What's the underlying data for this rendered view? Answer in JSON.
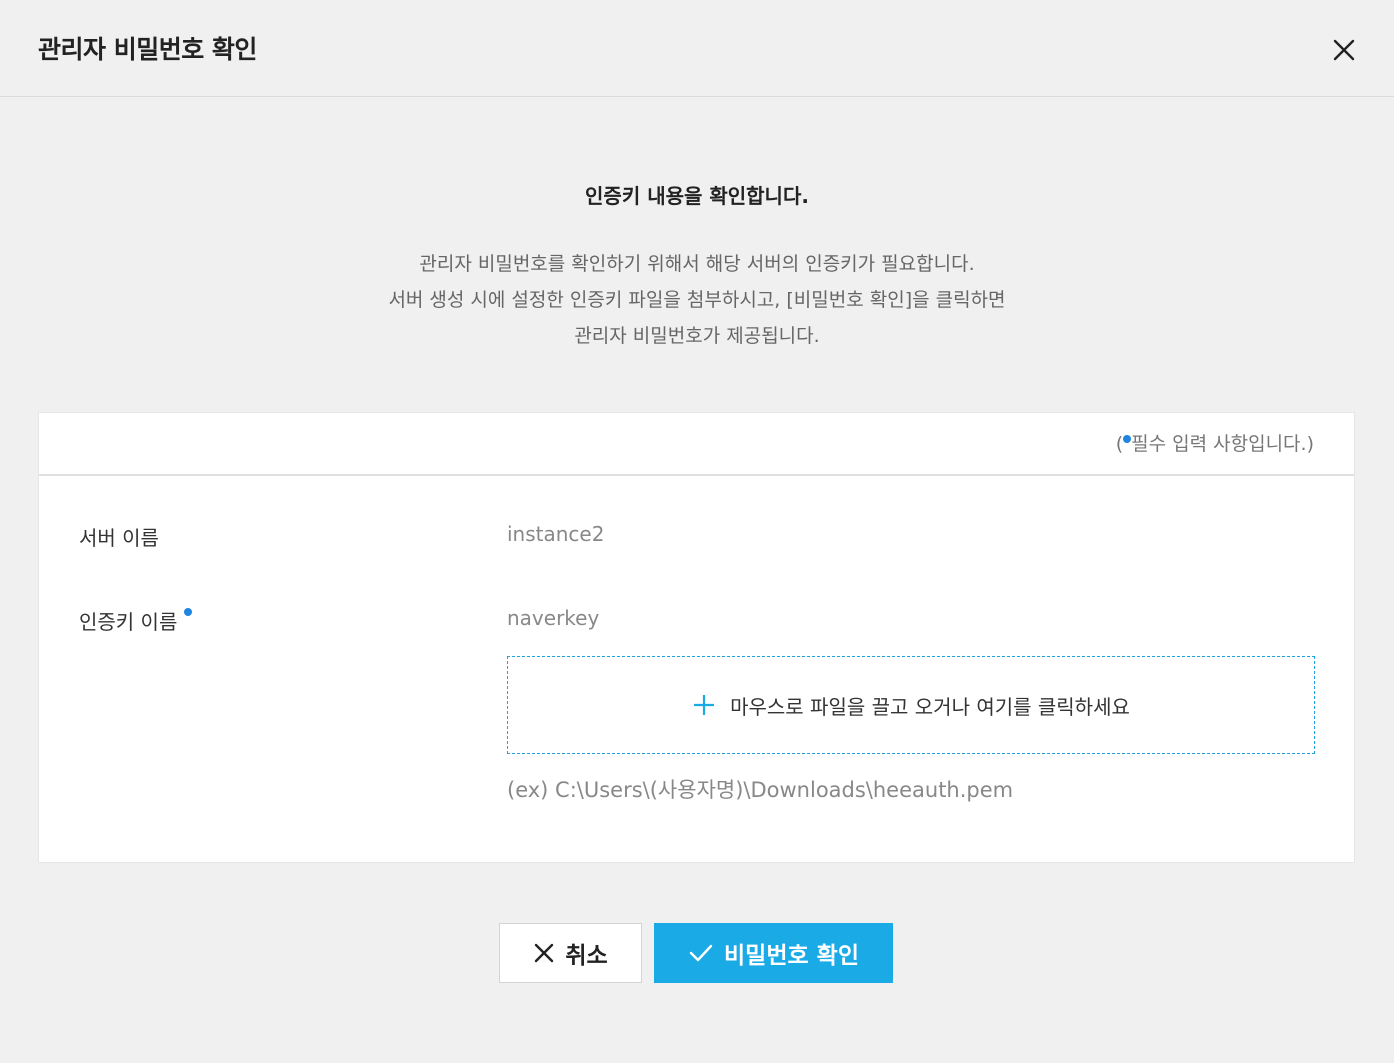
{
  "dialog": {
    "title": "관리자 비밀번호 확인"
  },
  "intro": {
    "title": "인증키 내용을 확인합니다.",
    "lines": [
      "관리자 비밀번호를 확인하기 위해서 해당 서버의 인증키가 필요합니다.",
      "서버 생성 시에 설정한 인증키 파일을 첨부하시고, [비밀번호 확인]을 클릭하면",
      "관리자 비밀번호가 제공됩니다."
    ]
  },
  "form": {
    "required_note_prefix": "(",
    "required_note_text": "필수 입력 사항입니다.)",
    "server_name_label": "서버 이름",
    "server_name_value": "instance2",
    "key_name_label": "인증키 이름",
    "key_name_value": "naverkey",
    "dropzone_text": "마우스로 파일을 끌고 오거나 여기를 클릭하세요",
    "path_example": "(ex) C:\\Users\\(사용자명)\\Downloads\\heeauth.pem"
  },
  "buttons": {
    "cancel_label": "취소",
    "confirm_label": "비밀번호 확인"
  },
  "colors": {
    "accent": "#1aabe6",
    "required_dot": "#1f85de",
    "background": "#f0f0f0"
  },
  "icons": {
    "close": "close-icon",
    "plus": "plus-icon",
    "cancel": "x-icon",
    "confirm": "check-icon"
  }
}
